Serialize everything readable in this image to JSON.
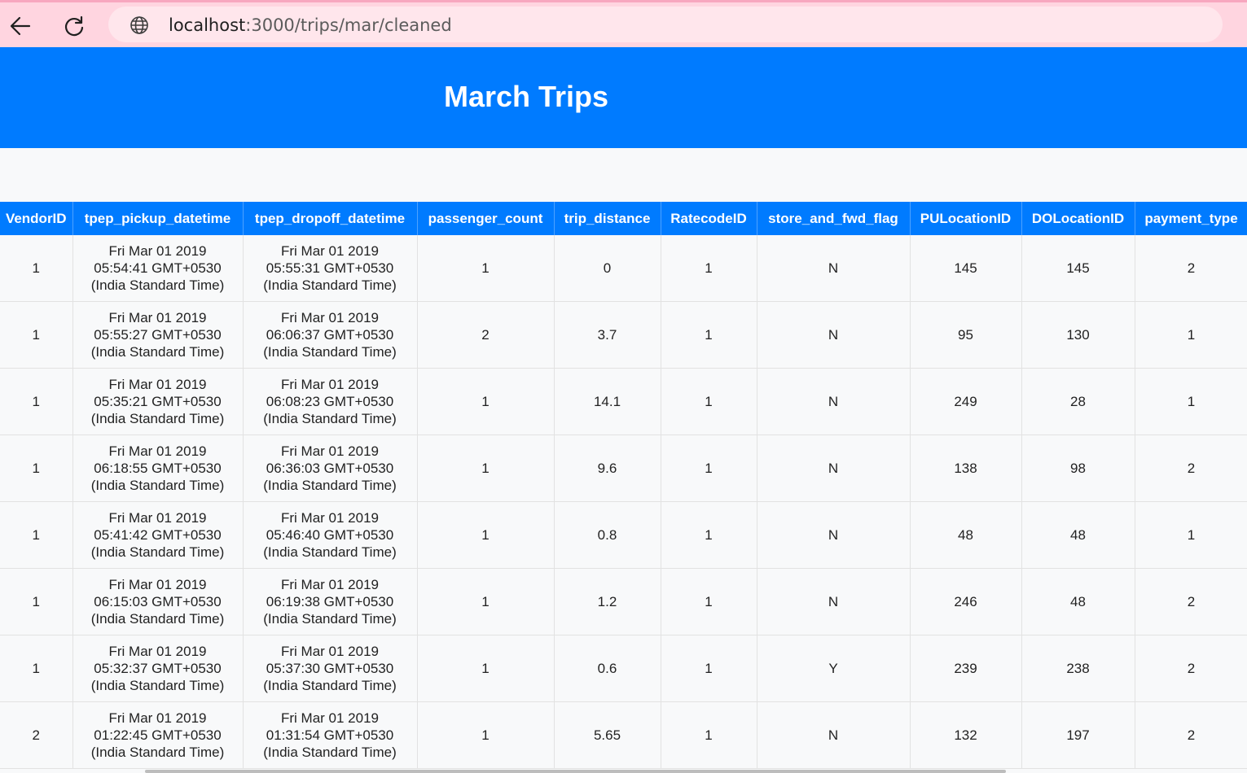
{
  "browser": {
    "url_host": "localhost",
    "url_path": ":3000/trips/mar/cleaned",
    "back_icon": "arrow-left-icon",
    "reload_icon": "reload-icon",
    "site_icon": "globe-icon"
  },
  "page": {
    "title": "March Trips"
  },
  "colors": {
    "accent": "#007bff",
    "browser_chrome": "#ffd5e0"
  },
  "table": {
    "columns": [
      "VendorID",
      "tpep_pickup_datetime",
      "tpep_dropoff_datetime",
      "passenger_count",
      "trip_distance",
      "RatecodeID",
      "store_and_fwd_flag",
      "PULocationID",
      "DOLocationID",
      "payment_type"
    ],
    "rows": [
      {
        "vendor": "1",
        "pickup": [
          "Fri Mar 01 2019",
          "05:54:41 GMT+0530",
          "(India Standard Time)"
        ],
        "dropoff": [
          "Fri Mar 01 2019",
          "05:55:31 GMT+0530",
          "(India Standard Time)"
        ],
        "passenger_count": "1",
        "trip_distance": "0",
        "ratecode": "1",
        "store_flag": "N",
        "pu_location": "145",
        "do_location": "145",
        "payment_type": "2"
      },
      {
        "vendor": "1",
        "pickup": [
          "Fri Mar 01 2019",
          "05:55:27 GMT+0530",
          "(India Standard Time)"
        ],
        "dropoff": [
          "Fri Mar 01 2019",
          "06:06:37 GMT+0530",
          "(India Standard Time)"
        ],
        "passenger_count": "2",
        "trip_distance": "3.7",
        "ratecode": "1",
        "store_flag": "N",
        "pu_location": "95",
        "do_location": "130",
        "payment_type": "1"
      },
      {
        "vendor": "1",
        "pickup": [
          "Fri Mar 01 2019",
          "05:35:21 GMT+0530",
          "(India Standard Time)"
        ],
        "dropoff": [
          "Fri Mar 01 2019",
          "06:08:23 GMT+0530",
          "(India Standard Time)"
        ],
        "passenger_count": "1",
        "trip_distance": "14.1",
        "ratecode": "1",
        "store_flag": "N",
        "pu_location": "249",
        "do_location": "28",
        "payment_type": "1"
      },
      {
        "vendor": "1",
        "pickup": [
          "Fri Mar 01 2019",
          "06:18:55 GMT+0530",
          "(India Standard Time)"
        ],
        "dropoff": [
          "Fri Mar 01 2019",
          "06:36:03 GMT+0530",
          "(India Standard Time)"
        ],
        "passenger_count": "1",
        "trip_distance": "9.6",
        "ratecode": "1",
        "store_flag": "N",
        "pu_location": "138",
        "do_location": "98",
        "payment_type": "2"
      },
      {
        "vendor": "1",
        "pickup": [
          "Fri Mar 01 2019",
          "05:41:42 GMT+0530",
          "(India Standard Time)"
        ],
        "dropoff": [
          "Fri Mar 01 2019",
          "05:46:40 GMT+0530",
          "(India Standard Time)"
        ],
        "passenger_count": "1",
        "trip_distance": "0.8",
        "ratecode": "1",
        "store_flag": "N",
        "pu_location": "48",
        "do_location": "48",
        "payment_type": "1"
      },
      {
        "vendor": "1",
        "pickup": [
          "Fri Mar 01 2019",
          "06:15:03 GMT+0530",
          "(India Standard Time)"
        ],
        "dropoff": [
          "Fri Mar 01 2019",
          "06:19:38 GMT+0530",
          "(India Standard Time)"
        ],
        "passenger_count": "1",
        "trip_distance": "1.2",
        "ratecode": "1",
        "store_flag": "N",
        "pu_location": "246",
        "do_location": "48",
        "payment_type": "2"
      },
      {
        "vendor": "1",
        "pickup": [
          "Fri Mar 01 2019",
          "05:32:37 GMT+0530",
          "(India Standard Time)"
        ],
        "dropoff": [
          "Fri Mar 01 2019",
          "05:37:30 GMT+0530",
          "(India Standard Time)"
        ],
        "passenger_count": "1",
        "trip_distance": "0.6",
        "ratecode": "1",
        "store_flag": "Y",
        "pu_location": "239",
        "do_location": "238",
        "payment_type": "2"
      },
      {
        "vendor": "2",
        "pickup": [
          "Fri Mar 01 2019",
          "01:22:45 GMT+0530",
          "(India Standard Time)"
        ],
        "dropoff": [
          "Fri Mar 01 2019",
          "01:31:54 GMT+0530",
          "(India Standard Time)"
        ],
        "passenger_count": "1",
        "trip_distance": "5.65",
        "ratecode": "1",
        "store_flag": "N",
        "pu_location": "132",
        "do_location": "197",
        "payment_type": "2"
      }
    ]
  }
}
